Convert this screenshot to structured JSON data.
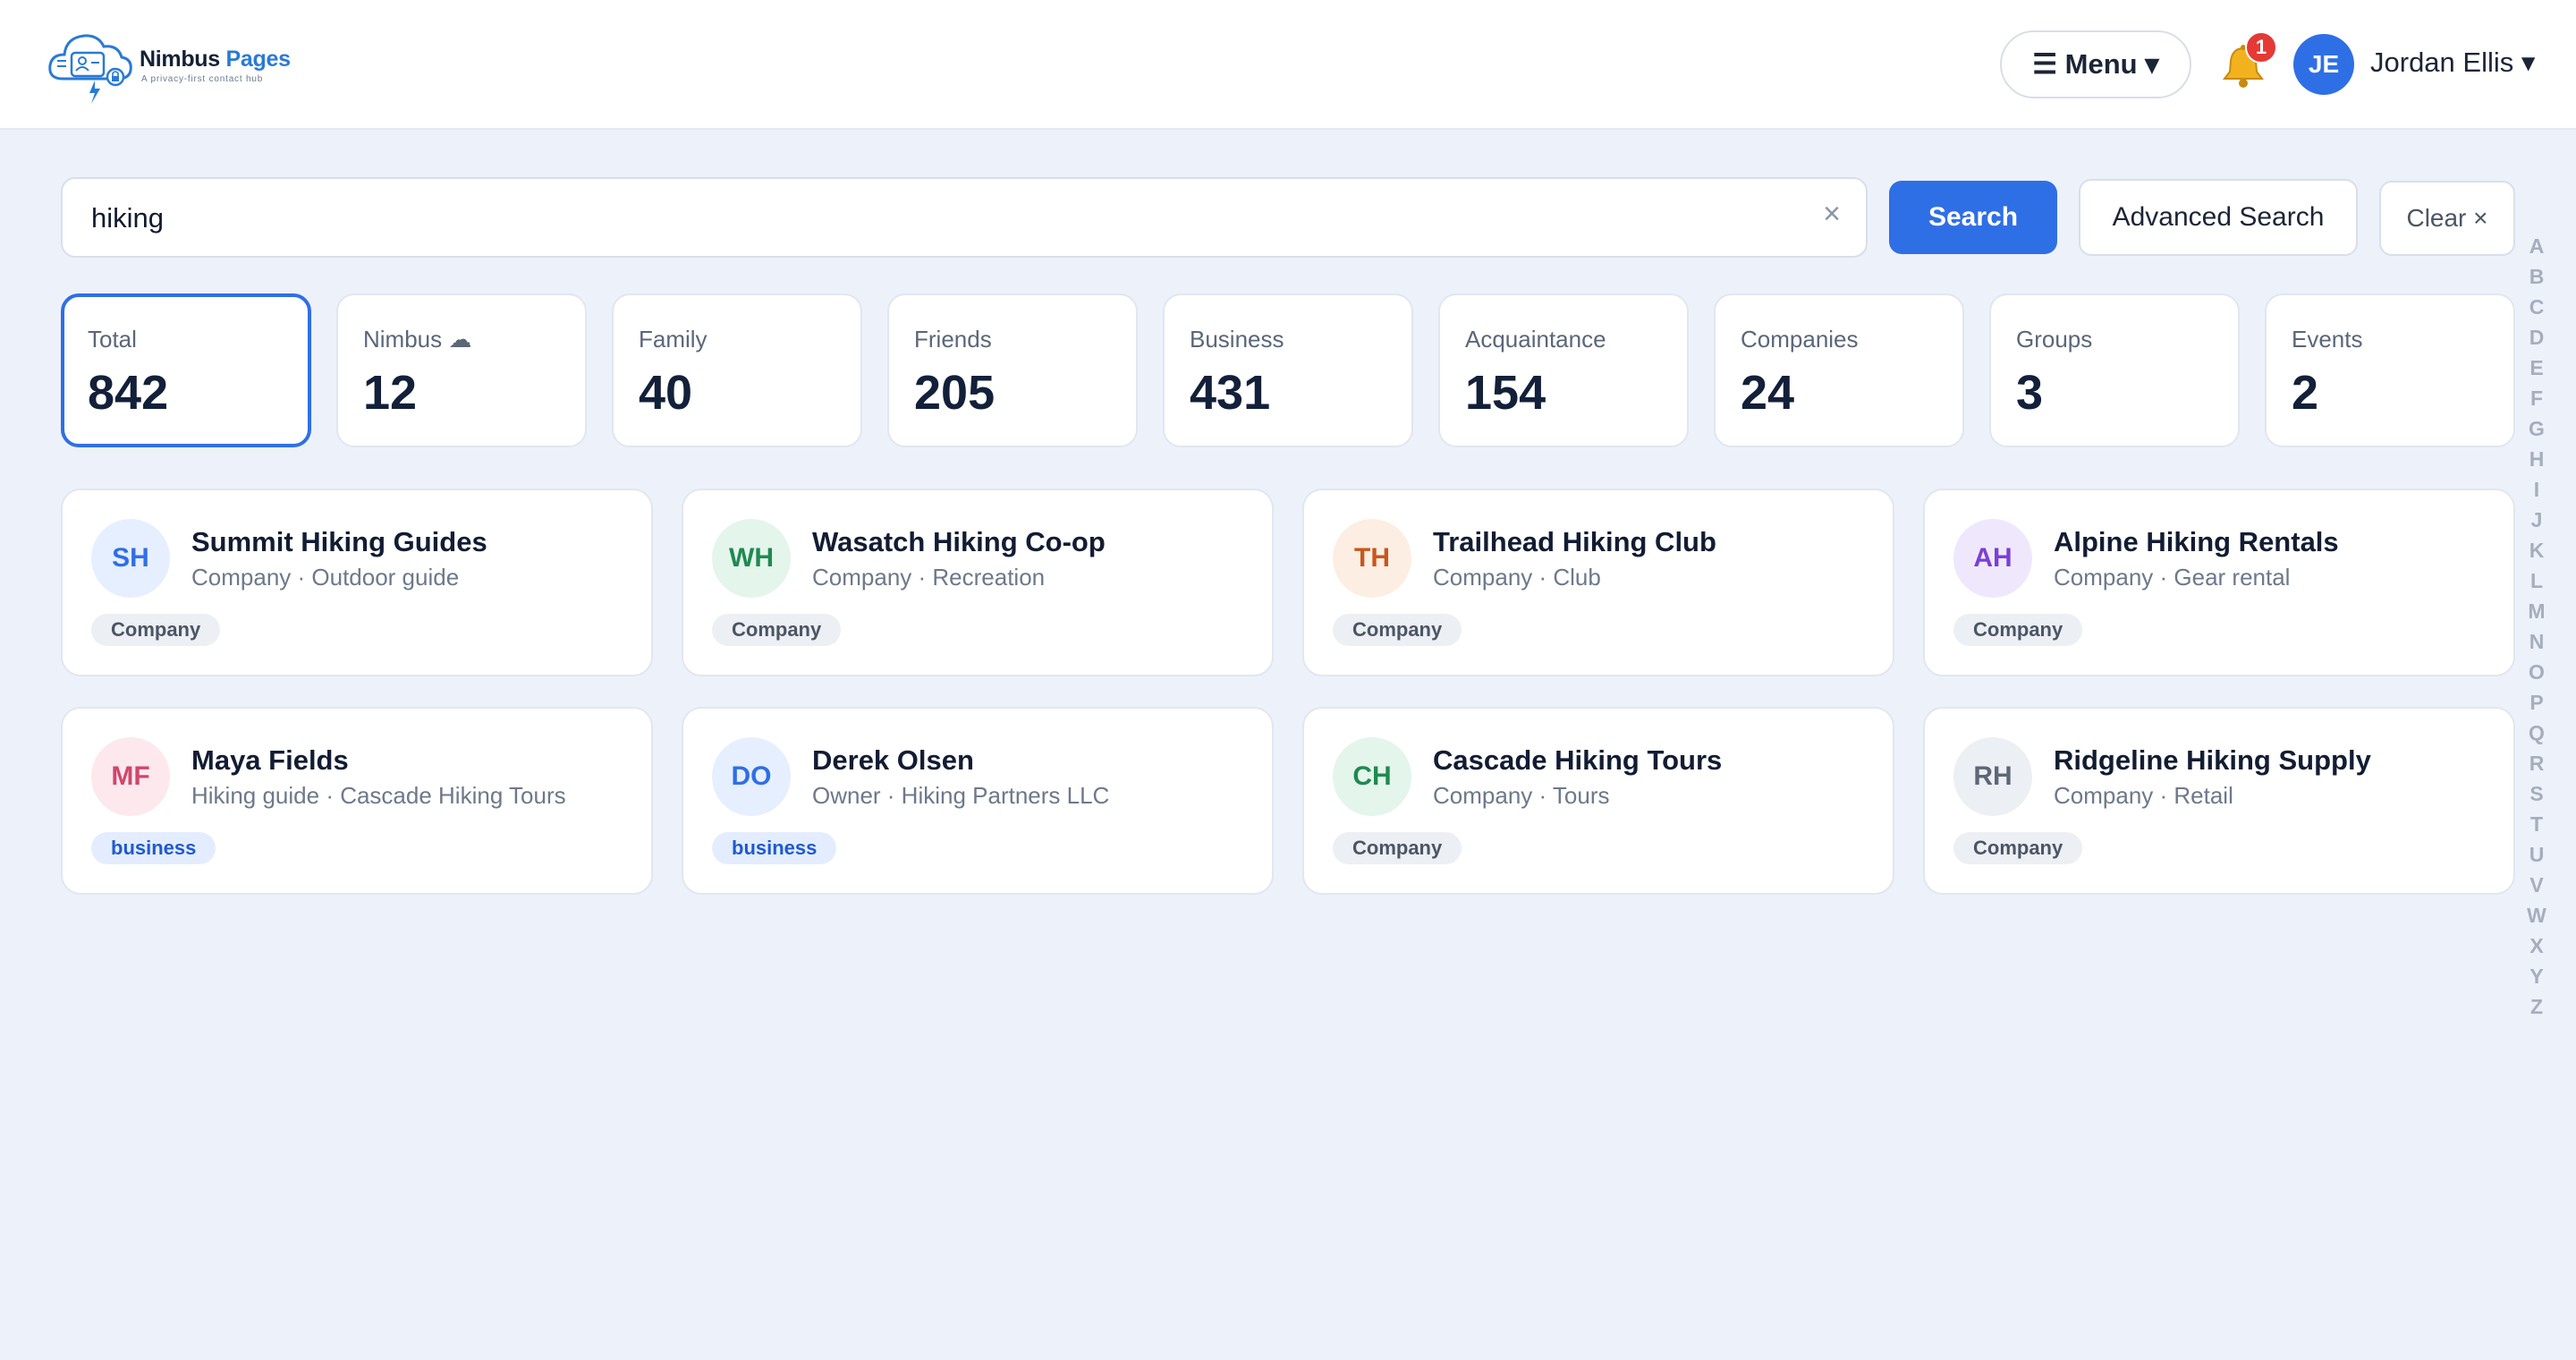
{
  "app": {
    "name_part1": "Nimbus",
    "name_part2": "Pages",
    "tagline": "A privacy-first contact hub"
  },
  "header": {
    "menu_label": "☰ Menu ▾",
    "notification_count": "1",
    "user_initials": "JE",
    "user_name": "Jordan Ellis ▾"
  },
  "search": {
    "value": "hiking",
    "clear_glyph": "×",
    "search_label": "Search",
    "advanced_label": "Advanced Search",
    "clear_label": "Clear ×"
  },
  "stats": [
    {
      "label": "Total",
      "value": "842"
    },
    {
      "label": "Nimbus ☁",
      "value": "12"
    },
    {
      "label": "Family",
      "value": "40"
    },
    {
      "label": "Friends",
      "value": "205"
    },
    {
      "label": "Business",
      "value": "431"
    },
    {
      "label": "Acquaintance",
      "value": "154"
    },
    {
      "label": "Companies",
      "value": "24"
    },
    {
      "label": "Groups",
      "value": "3"
    },
    {
      "label": "Events",
      "value": "2"
    }
  ],
  "results": [
    {
      "initials": "SH",
      "name": "Summit Hiking Guides",
      "subtitle": "Company · Outdoor guide",
      "tag": "Company",
      "avatar_bg": "#e6efff",
      "avatar_fg": "#2f6fe6"
    },
    {
      "initials": "WH",
      "name": "Wasatch Hiking Co-op",
      "subtitle": "Company · Recreation",
      "tag": "Company",
      "avatar_bg": "#e4f5ec",
      "avatar_fg": "#1f8a4f"
    },
    {
      "initials": "TH",
      "name": "Trailhead Hiking Club",
      "subtitle": "Company · Club",
      "tag": "Company",
      "avatar_bg": "#fdeee3",
      "avatar_fg": "#c9561d"
    },
    {
      "initials": "AH",
      "name": "Alpine Hiking Rentals",
      "subtitle": "Company · Gear rental",
      "tag": "Company",
      "avatar_bg": "#efe8fd",
      "avatar_fg": "#7a3fd6"
    },
    {
      "initials": "MF",
      "name": "Maya Fields",
      "subtitle": "Hiking guide · Cascade Hiking Tours",
      "tag": "business",
      "avatar_bg": "#fde8ee",
      "avatar_fg": "#d0466c"
    },
    {
      "initials": "DO",
      "name": "Derek Olsen",
      "subtitle": "Owner · Hiking Partners LLC",
      "tag": "business",
      "avatar_bg": "#e6efff",
      "avatar_fg": "#2f6fe6"
    },
    {
      "initials": "CH",
      "name": "Cascade Hiking Tours",
      "subtitle": "Company · Tours",
      "tag": "Company",
      "avatar_bg": "#e4f5ec",
      "avatar_fg": "#1f8a4f"
    },
    {
      "initials": "RH",
      "name": "Ridgeline Hiking Supply",
      "subtitle": "Company · Retail",
      "tag": "Company",
      "avatar_bg": "#eceff4",
      "avatar_fg": "#5d6778"
    }
  ],
  "alphabet": [
    "A",
    "B",
    "C",
    "D",
    "E",
    "F",
    "G",
    "H",
    "I",
    "J",
    "K",
    "L",
    "M",
    "N",
    "O",
    "P",
    "Q",
    "R",
    "S",
    "T",
    "U",
    "V",
    "W",
    "X",
    "Y",
    "Z"
  ]
}
